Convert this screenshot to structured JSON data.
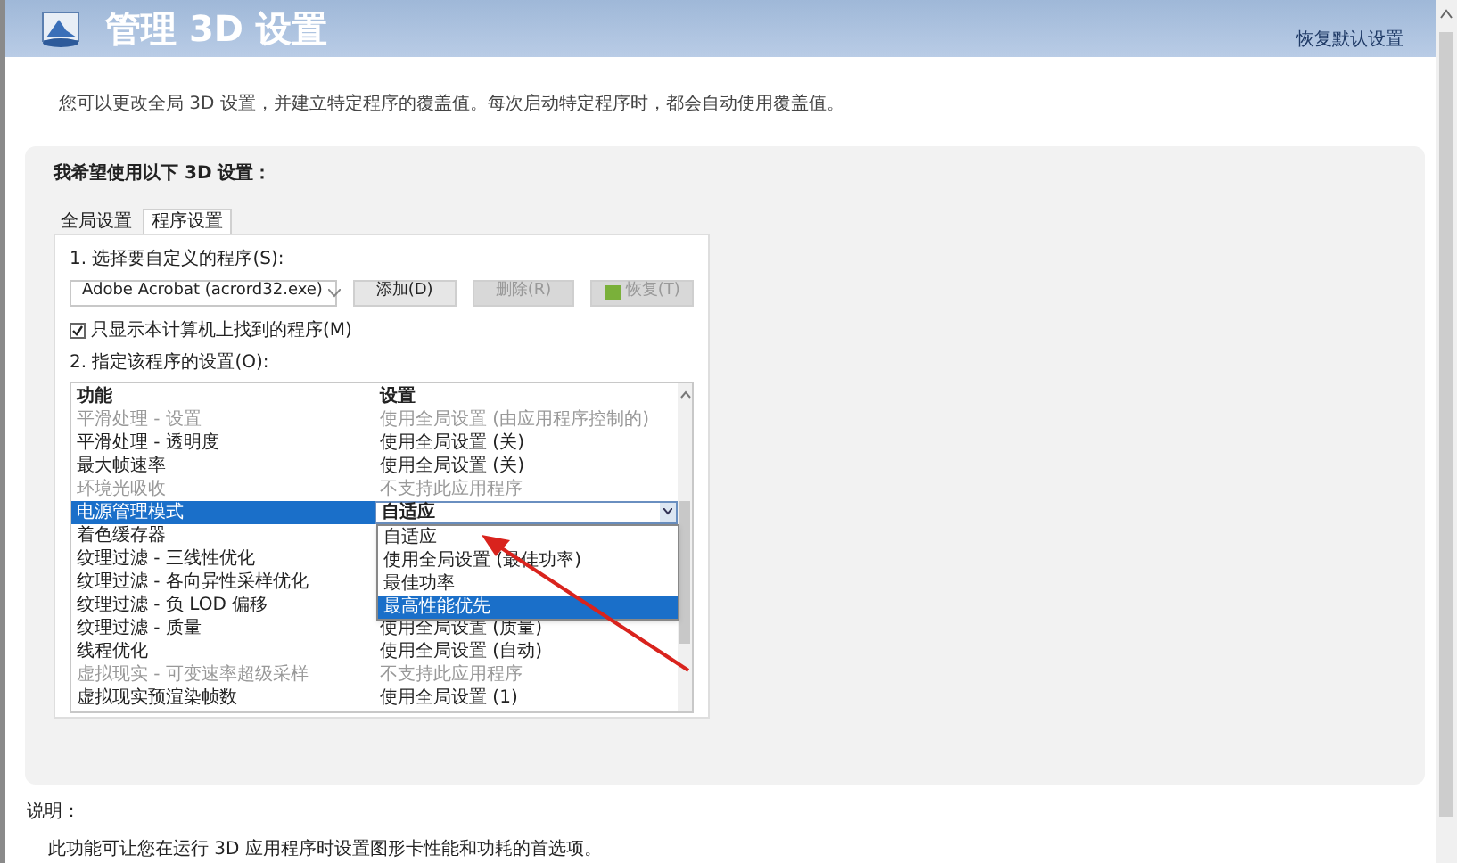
{
  "window": {
    "title": "管理 3D 设置",
    "restore_link": "恢复默认设置"
  },
  "description": "您可以更改全局 3D 设置，并建立特定程序的覆盖值。每次启动特定程序时，都会自动使用覆盖值。",
  "panel": {
    "heading": "我希望使用以下 3D 设置：",
    "tabs": [
      {
        "label": "全局设置",
        "selected": false
      },
      {
        "label": "程序设置",
        "selected": true
      }
    ],
    "step1": "1. 选择要自定义的程序(S):",
    "program": "Adobe Acrobat (acrord32.exe)",
    "buttons": [
      {
        "label": "添加(D)",
        "disabled": false,
        "kind": "plain"
      },
      {
        "label": "删除(R)",
        "disabled": true,
        "kind": "plain"
      },
      {
        "label": "恢复(T)",
        "disabled": true,
        "kind": "icon"
      }
    ],
    "checkbox": {
      "label": "只显示本计算机上找到的程序(M)",
      "checked": true
    },
    "step2": "2. 指定该程序的设置(O):",
    "table": {
      "columns": [
        "功能",
        "设置"
      ],
      "rows": [
        {
          "feature": "平滑处理 - 设置",
          "setting": "使用全局设置 (由应用程序控制的)",
          "disabled": true,
          "selected": false
        },
        {
          "feature": "平滑处理 - 透明度",
          "setting": "使用全局设置 (关)",
          "disabled": false,
          "selected": false
        },
        {
          "feature": "最大帧速率",
          "setting": "使用全局设置 (关)",
          "disabled": false,
          "selected": false
        },
        {
          "feature": "环境光吸收",
          "setting": "不支持此应用程序",
          "disabled": true,
          "selected": false
        },
        {
          "feature": "电源管理模式",
          "setting": "自适应",
          "disabled": false,
          "selected": true
        },
        {
          "feature": "着色缓存器",
          "disabled": false,
          "selected": false
        },
        {
          "feature": "纹理过滤 - 三线性优化",
          "disabled": false,
          "selected": false
        },
        {
          "feature": "纹理过滤 - 各向异性采样优化",
          "disabled": false,
          "selected": false
        },
        {
          "feature": "纹理过滤 - 负 LOD 偏移",
          "disabled": false,
          "selected": false
        },
        {
          "feature": "纹理过滤 - 质量",
          "setting": "使用全局设置 (质量)",
          "disabled": false,
          "selected": false
        },
        {
          "feature": "线程优化",
          "setting": "使用全局设置 (自动)",
          "disabled": false,
          "selected": false
        },
        {
          "feature": "虚拟现实 - 可变速率超级采样",
          "setting": "不支持此应用程序",
          "disabled": true,
          "selected": false
        },
        {
          "feature": "虚拟现实预渲染帧数",
          "setting": "使用全局设置 (1)",
          "disabled": false,
          "selected": false
        }
      ],
      "dropdown_options": [
        {
          "label": "自适应",
          "selected": false
        },
        {
          "label": "使用全局设置 (最佳功率)",
          "selected": false
        },
        {
          "label": "最佳功率",
          "selected": false
        },
        {
          "label": "最高性能优先",
          "selected": true
        }
      ]
    }
  },
  "footer": {
    "label": "说明：",
    "text": "此功能可让您在运行 3D 应用程序时设置图形卡性能和功耗的首选项。"
  }
}
